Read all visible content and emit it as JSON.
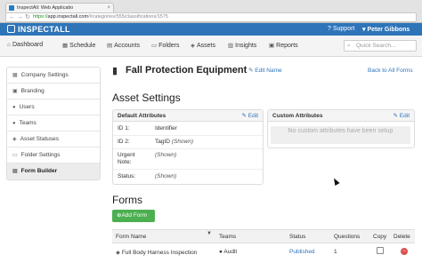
{
  "browser": {
    "tab_title": "InspectAll: Web Applicatio",
    "url_https": "https://",
    "url_host": "app.inspectall.com",
    "url_path": "/#categories/555/classifications/1575"
  },
  "header": {
    "logo": "INSPECTALL",
    "support_label": "Support",
    "user_name": "Peter Gibbons",
    "brand_color": "#2e74b9"
  },
  "nav": {
    "items": [
      {
        "label": "Dashboard",
        "icon": "home-icon"
      },
      {
        "label": "Schedule",
        "icon": "calendar-icon"
      },
      {
        "label": "Accounts",
        "icon": "briefcase-icon"
      },
      {
        "label": "Folders",
        "icon": "folder-icon"
      },
      {
        "label": "Assets",
        "icon": "tag-icon"
      },
      {
        "label": "Insights",
        "icon": "chart-icon"
      },
      {
        "label": "Reports",
        "icon": "document-icon"
      }
    ],
    "search_placeholder": "Quick Search..."
  },
  "sidebar": {
    "items": [
      {
        "label": "Company Settings",
        "active": false
      },
      {
        "label": "Branding",
        "active": false
      },
      {
        "label": "Users",
        "active": false
      },
      {
        "label": "Teams",
        "active": false
      },
      {
        "label": "Asset Statuses",
        "active": false
      },
      {
        "label": "Folder Settings",
        "active": false
      },
      {
        "label": "Form Builder",
        "active": true
      }
    ]
  },
  "asset": {
    "title": "Fall Protection Equipment",
    "edit_name": "Edit Name",
    "back_link": "Back to All Forms"
  },
  "settings": {
    "heading": "Asset Settings",
    "default_attributes": {
      "title": "Default Attributes",
      "edit": "Edit",
      "rows": [
        {
          "label": "ID 1:",
          "value": "Identifier",
          "shown": ""
        },
        {
          "label": "ID 2:",
          "value": "TagID",
          "shown": "(Shown)"
        },
        {
          "label": "Urgent Note:",
          "value": "",
          "shown": "(Shown)"
        },
        {
          "label": "Status:",
          "value": "",
          "shown": "(Shown)"
        }
      ]
    },
    "custom_attributes": {
      "title": "Custom Attributes",
      "edit": "Edit",
      "empty_message": "No custom attributes have been setup"
    }
  },
  "forms": {
    "heading": "Forms",
    "add_button": "Add Form",
    "columns": [
      "Form Name",
      "Teams",
      "Status",
      "Questions",
      "Copy",
      "Delete"
    ],
    "rows": [
      {
        "name": "Full Body Harness Inspection",
        "teams": "Audit",
        "status": "Published",
        "questions": "1"
      }
    ]
  }
}
